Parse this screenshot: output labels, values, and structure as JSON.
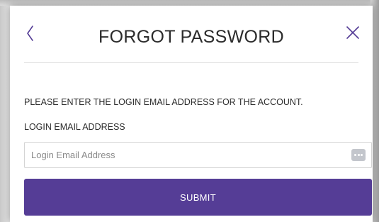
{
  "dialog": {
    "title": "FORGOT PASSWORD",
    "back_icon": "chevron-left-icon",
    "close_icon": "close-icon"
  },
  "form": {
    "instruction": "PLEASE ENTER THE LOGIN EMAIL ADDRESS FOR THE ACCOUNT.",
    "email_label": "LOGIN EMAIL ADDRESS",
    "email_value": "",
    "email_placeholder": "Login Email Address",
    "password_manager_icon": "dots-icon",
    "submit_label": "SUBMIT"
  },
  "colors": {
    "accent": "#553d96",
    "text": "#2b2b2b",
    "divider": "#dedede"
  }
}
